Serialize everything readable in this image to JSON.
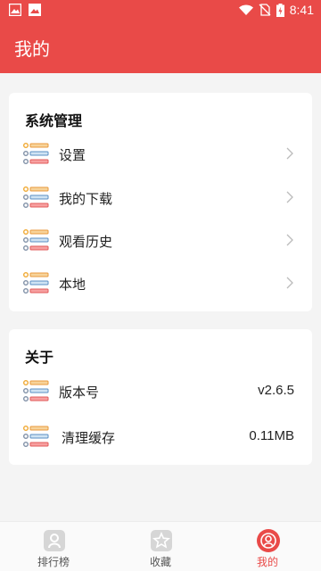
{
  "status_bar": {
    "time": "8:41"
  },
  "app_bar": {
    "title": "我的"
  },
  "system_section": {
    "title": "系统管理",
    "items": [
      {
        "label": "设置"
      },
      {
        "label": "我的下载"
      },
      {
        "label": "观看历史"
      },
      {
        "label": "本地"
      }
    ]
  },
  "about_section": {
    "title": "关于",
    "items": [
      {
        "label": "版本号",
        "value": "v2.6.5"
      },
      {
        "label": "清理缓存",
        "value": "0.11MB"
      }
    ]
  },
  "tabs": [
    {
      "label": "排行榜",
      "icon": "ranking-icon",
      "active": false
    },
    {
      "label": "收藏",
      "icon": "star-icon",
      "active": false
    },
    {
      "label": "我的",
      "icon": "user-icon",
      "active": true
    }
  ],
  "colors": {
    "accent": "#e94a48",
    "background": "#f4f4f4"
  }
}
